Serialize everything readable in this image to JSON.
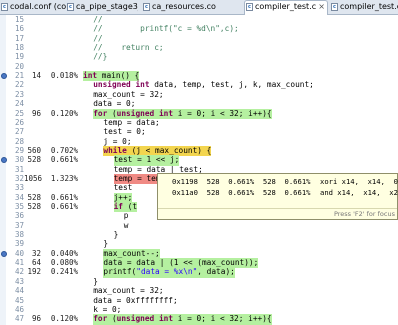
{
  "tabs": [
    {
      "label": "codal.conf (cod",
      "active": false
    },
    {
      "label": "ca_pipe_stage3_",
      "active": false
    },
    {
      "label": "ca_resources.co",
      "active": false
    },
    {
      "label": "compiler_test.c",
      "active": true,
      "close": "×"
    },
    {
      "label": "compiler_test.c",
      "active": false
    }
  ],
  "lines": [
    {
      "ln": "15",
      "count": "",
      "pct": "",
      "code": "//",
      "indent": 1,
      "hl": ""
    },
    {
      "ln": "16",
      "count": "",
      "pct": "",
      "code": "//        printf(\"c = %d\\n\",c);",
      "indent": 1,
      "hl": ""
    },
    {
      "ln": "17",
      "count": "",
      "pct": "",
      "code": "//",
      "indent": 1,
      "hl": ""
    },
    {
      "ln": "18",
      "count": "",
      "pct": "",
      "code": "//    return c;",
      "indent": 1,
      "hl": ""
    },
    {
      "ln": "19",
      "count": "",
      "pct": "",
      "code": "//}",
      "indent": 1,
      "hl": ""
    },
    {
      "ln": "20",
      "count": "",
      "pct": "",
      "code": "",
      "indent": 0,
      "hl": ""
    },
    {
      "ln": "21",
      "count": "14",
      "pct": "0.018%",
      "code": "int main() {",
      "indent": 0,
      "hl": "green"
    },
    {
      "ln": "22",
      "count": "",
      "pct": "",
      "code": "unsigned int data, temp, test, j, k, max_count;",
      "indent": 1,
      "hl": ""
    },
    {
      "ln": "23",
      "count": "",
      "pct": "",
      "code": "max_count = 32;",
      "indent": 1,
      "hl": ""
    },
    {
      "ln": "24",
      "count": "",
      "pct": "",
      "code": "data = 0;",
      "indent": 1,
      "hl": ""
    },
    {
      "ln": "25",
      "count": "96",
      "pct": "0.120%",
      "code": "for (unsigned int i = 0; i < 32; i++){",
      "indent": 1,
      "hl": "green"
    },
    {
      "ln": "26",
      "count": "",
      "pct": "",
      "code": "temp = data;",
      "indent": 2,
      "hl": ""
    },
    {
      "ln": "27",
      "count": "",
      "pct": "",
      "code": "test = 0;",
      "indent": 2,
      "hl": ""
    },
    {
      "ln": "28",
      "count": "",
      "pct": "",
      "code": "j = 0;",
      "indent": 2,
      "hl": ""
    },
    {
      "ln": "29",
      "count": "560",
      "pct": "0.702%",
      "code": "while (j < max_count) {",
      "indent": 2,
      "hl": "yellow"
    },
    {
      "ln": "30",
      "count": "528",
      "pct": "0.661%",
      "code": "test = 1 << j;",
      "indent": 3,
      "hl": "green"
    },
    {
      "ln": "31",
      "count": "",
      "pct": "",
      "code": "temp = data | test;",
      "indent": 3,
      "hl": ""
    },
    {
      "ln": "32",
      "count": "1056",
      "pct": "1.323%",
      "code": "temp = temp & ~test;",
      "indent": 3,
      "hl": "red"
    },
    {
      "ln": "33",
      "count": "",
      "pct": "",
      "code": "test",
      "indent": 3,
      "hl": ""
    },
    {
      "ln": "34",
      "count": "528",
      "pct": "0.661%",
      "code": "j++;",
      "indent": 3,
      "hl": "green"
    },
    {
      "ln": "35",
      "count": "528",
      "pct": "0.661%",
      "code": "if (t",
      "indent": 3,
      "hl": "green"
    },
    {
      "ln": "36",
      "count": "",
      "pct": "",
      "code": "p",
      "indent": 4,
      "hl": ""
    },
    {
      "ln": "37",
      "count": "",
      "pct": "",
      "code": "w",
      "indent": 4,
      "hl": ""
    },
    {
      "ln": "38",
      "count": "",
      "pct": "",
      "code": "}",
      "indent": 3,
      "hl": ""
    },
    {
      "ln": "39",
      "count": "",
      "pct": "",
      "code": "}",
      "indent": 2,
      "hl": ""
    },
    {
      "ln": "40",
      "count": "32",
      "pct": "0.040%",
      "code": "max_count--;",
      "indent": 2,
      "hl": "green"
    },
    {
      "ln": "41",
      "count": "64",
      "pct": "0.080%",
      "code": "data = data | (1 << (max_count));",
      "indent": 2,
      "hl": "green"
    },
    {
      "ln": "42",
      "count": "192",
      "pct": "0.241%",
      "code": "printf(\"data = %x\\n\", data);",
      "indent": 2,
      "hl": "green"
    },
    {
      "ln": "43",
      "count": "",
      "pct": "",
      "code": "}",
      "indent": 1,
      "hl": ""
    },
    {
      "ln": "44",
      "count": "",
      "pct": "",
      "code": "max_count = 32;",
      "indent": 1,
      "hl": ""
    },
    {
      "ln": "45",
      "count": "",
      "pct": "",
      "code": "data = 0xffffffff;",
      "indent": 1,
      "hl": ""
    },
    {
      "ln": "46",
      "count": "",
      "pct": "",
      "code": "k = 0;",
      "indent": 1,
      "hl": ""
    },
    {
      "ln": "47",
      "count": "96",
      "pct": "0.120%",
      "code": "for (unsigned int i = 0; i < 32; i++){",
      "indent": 1,
      "hl": "green"
    }
  ],
  "popup": {
    "rows": [
      {
        "left": "0x1198  528  0.661%  528  0.661%",
        "right": "xori x14,  x14,  0xfff"
      },
      {
        "left": "0x11a0  528  0.661%  528  0.661%",
        "right": "and x14,  x14,  x21"
      }
    ],
    "hint": "Press 'F2' for focus"
  },
  "colors": {
    "green": "#b5f0a0",
    "yellow": "#f3d54f",
    "red": "#f08a84",
    "keyword": "#7f0055",
    "comment": "#3f7f5f",
    "string": "#2a00ff"
  },
  "icons": [
    "c-file-icon",
    "breakpoint-marker-icon",
    "close-icon"
  ]
}
